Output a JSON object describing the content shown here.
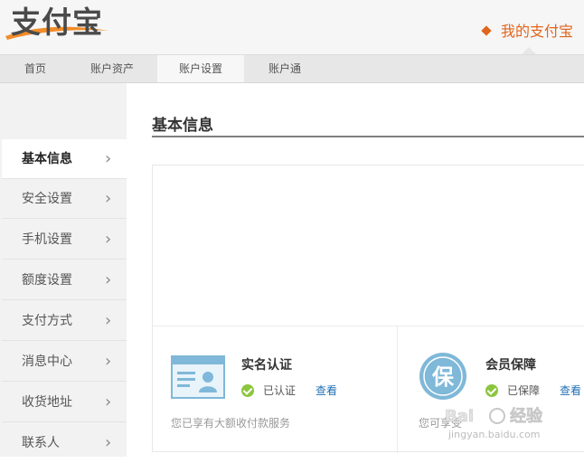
{
  "header": {
    "logo_text": "支付宝",
    "my_alipay_label": "我的支付宝"
  },
  "nav": {
    "items": [
      {
        "label": "首页"
      },
      {
        "label": "账户资产"
      },
      {
        "label": "账户设置"
      },
      {
        "label": "账户通"
      }
    ],
    "active_index": 2
  },
  "sidebar": {
    "items": [
      {
        "label": "基本信息"
      },
      {
        "label": "安全设置"
      },
      {
        "label": "手机设置"
      },
      {
        "label": "额度设置"
      },
      {
        "label": "支付方式"
      },
      {
        "label": "消息中心"
      },
      {
        "label": "收货地址"
      },
      {
        "label": "联系人"
      }
    ],
    "active_index": 0
  },
  "main": {
    "title": "基本信息",
    "features": [
      {
        "title": "实名认证",
        "status": "已认证",
        "link": "查看",
        "desc": "您已享有大额收付款服务",
        "icon": "id-card-icon"
      },
      {
        "title": "会员保障",
        "status": "已保障",
        "link": "查看",
        "desc": "您可享受",
        "icon_char": "保",
        "icon": "protection-badge-icon"
      }
    ]
  },
  "watermark": {
    "brand": "Bai",
    "brand_suffix": "经验",
    "url": "jingyan.baidu.com"
  },
  "colors": {
    "accent_orange": "#e0661d",
    "link_blue": "#1f6fb5",
    "check_green": "#8cc63e",
    "icon_blue": "#7fb8d8"
  }
}
